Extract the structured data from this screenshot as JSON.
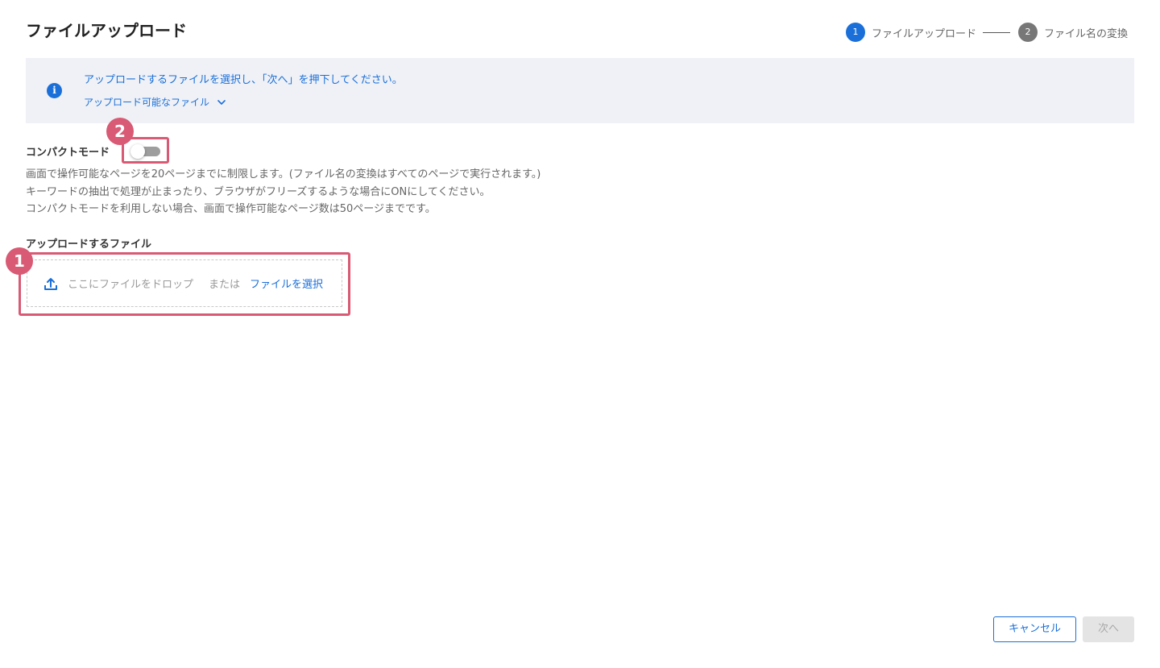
{
  "page": {
    "title": "ファイルアップロード"
  },
  "stepper": {
    "steps": [
      {
        "number": "1",
        "label": "ファイルアップロード",
        "active": true
      },
      {
        "number": "2",
        "label": "ファイル名の変換",
        "active": false
      }
    ],
    "connector": "——"
  },
  "info": {
    "icon": "info-icon",
    "message": "アップロードするファイルを選択し、「次へ」を押下してください。",
    "link_label": "アップロード可能なファイル"
  },
  "compact_mode": {
    "label": "コンパクトモード",
    "enabled": false,
    "description": [
      "画面で操作可能なページを20ページまでに制限します。(ファイル名の変換はすべてのページで実行されます。)",
      "キーワードの抽出で処理が止まったり、ブラウザがフリーズするような場合にONにしてください。",
      "コンパクトモードを利用しない場合、画面で操作可能なページ数は50ページまでです。"
    ]
  },
  "upload": {
    "title": "アップロードするファイル",
    "drop_text": "ここにファイルをドロップ",
    "or_text": "または",
    "select_link": "ファイルを選択"
  },
  "annotations": {
    "badge_1": "1",
    "badge_2": "2"
  },
  "footer": {
    "cancel_label": "キャンセル",
    "next_label": "次へ"
  },
  "colors": {
    "accent": "#1a6fd8",
    "highlight": "#d85a74",
    "banner_bg": "#eff1f6",
    "disabled_bg": "#e4e4e4"
  }
}
